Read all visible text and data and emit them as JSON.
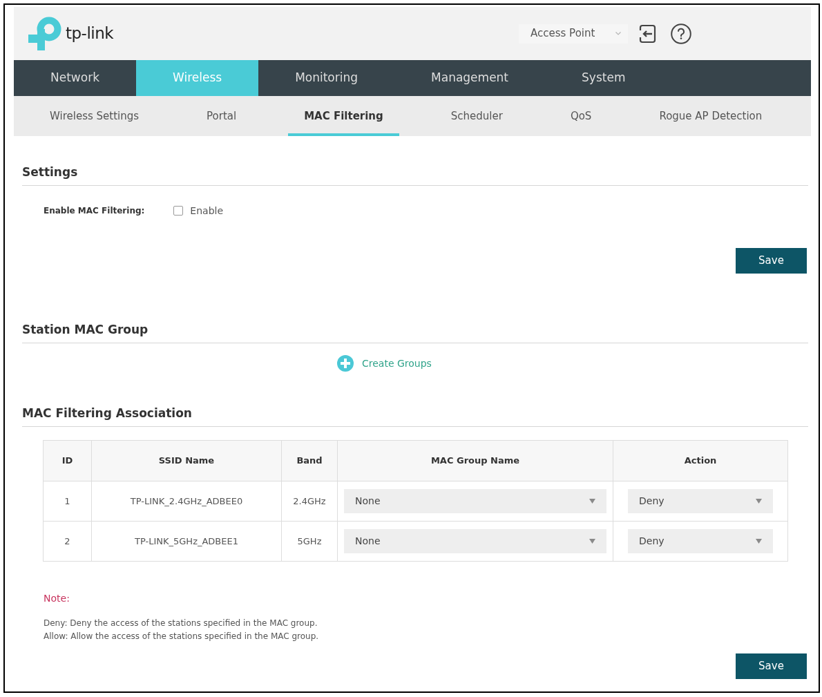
{
  "header": {
    "logo_text": "tp-link",
    "mode_select": {
      "value": "Access Point"
    }
  },
  "main_nav": [
    {
      "label": "Network",
      "selected": false
    },
    {
      "label": "Wireless",
      "selected": true
    },
    {
      "label": "Monitoring",
      "selected": false
    },
    {
      "label": "Management",
      "selected": false
    },
    {
      "label": "System",
      "selected": false
    }
  ],
  "sub_nav": [
    {
      "label": "Wireless Settings",
      "selected": false
    },
    {
      "label": "Portal",
      "selected": false
    },
    {
      "label": "MAC Filtering",
      "selected": true
    },
    {
      "label": "Scheduler",
      "selected": false
    },
    {
      "label": "QoS",
      "selected": false
    },
    {
      "label": "Rogue AP Detection",
      "selected": false
    }
  ],
  "settings": {
    "title": "Settings",
    "enable_field": {
      "label": "Enable MAC Filtering:",
      "option": "Enable",
      "checked": false
    },
    "save_button": "Save"
  },
  "station_mac_group": {
    "title": "Station MAC Group",
    "create_link": "Create Groups"
  },
  "association": {
    "title": "MAC Filtering Association",
    "table": {
      "columns": [
        "ID",
        "SSID Name",
        "Band",
        "MAC Group Name",
        "Action"
      ],
      "rows": [
        {
          "id": "1",
          "ssid_name": "TP-LINK_2.4GHz_ADBEE0",
          "band": "2.4GHz",
          "mac_group_name": "None",
          "action": "Deny"
        },
        {
          "id": "2",
          "ssid_name": "TP-LINK_5GHz_ADBEE1",
          "band": "5GHz",
          "mac_group_name": "None",
          "action": "Deny"
        }
      ]
    }
  },
  "note": {
    "title": "Note:",
    "lines": [
      "Deny: Deny the access of the stations specified in the MAC group.",
      "Allow: Allow the access of the stations specified in the MAC group."
    ]
  },
  "save_button": "Save"
}
